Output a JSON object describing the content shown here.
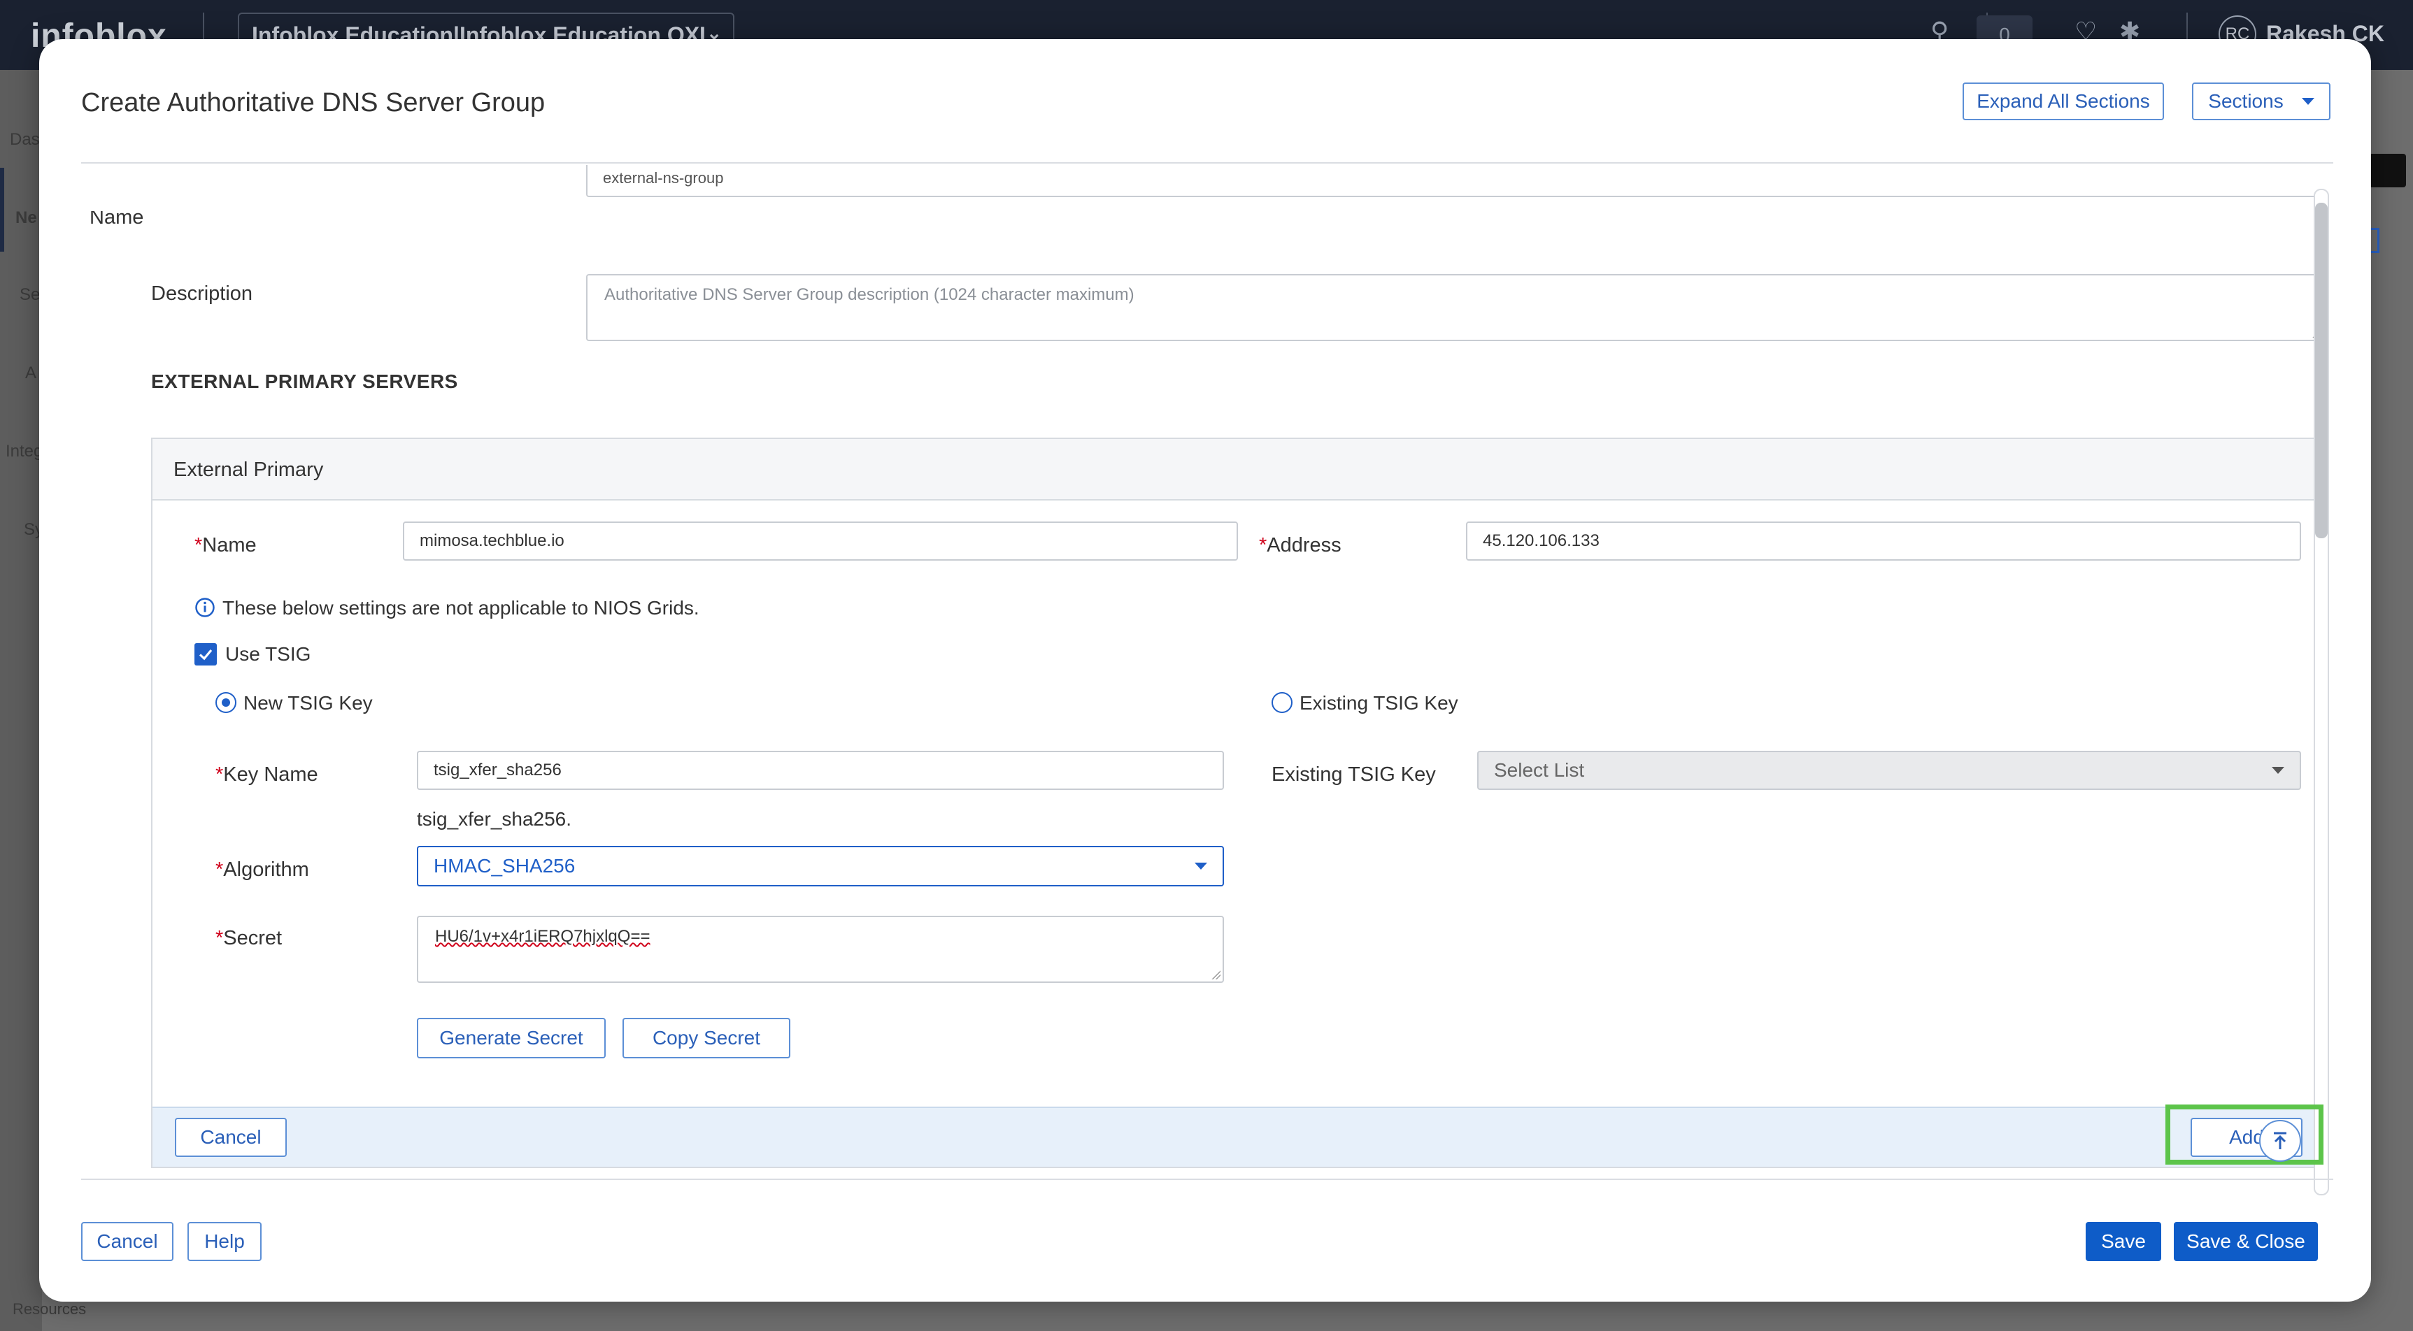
{
  "background": {
    "logo": "infoblox",
    "tenant": "Infoblox Education|Infoblox Education OXI",
    "notification_count": "0",
    "user_initials": "RC",
    "user_name": "Rakesh CK",
    "nav_fragments": [
      "Das",
      "Ne",
      "Se",
      "A",
      "Integ",
      "Sy",
      "Resources"
    ]
  },
  "modal": {
    "title": "Create Authoritative DNS Server Group",
    "expand_label": "Expand All Sections",
    "sections_label": "Sections",
    "footer": {
      "cancel": "Cancel",
      "help": "Help",
      "save": "Save",
      "save_close": "Save & Close"
    }
  },
  "form": {
    "name_label": "Name",
    "name_value": "external-ns-group",
    "description_label": "Description",
    "description_placeholder": "Authoritative DNS Server Group description (1024 character maximum)",
    "section_title": "EXTERNAL PRIMARY SERVERS"
  },
  "panel": {
    "title": "External Primary",
    "name_label": "Name",
    "name_value": "mimosa.techblue.io",
    "address_label": "Address",
    "address_value": "45.120.106.133",
    "info_text": "These below settings are not applicable to NIOS Grids.",
    "use_tsig_label": "Use TSIG",
    "use_tsig_checked": true,
    "new_tsig_label": "New TSIG Key",
    "existing_tsig_radio_label": "Existing TSIG Key",
    "key_name_label": "Key Name",
    "key_name_value": "tsig_xfer_sha256",
    "key_name_hint": "tsig_xfer_sha256.",
    "existing_tsig_label": "Existing TSIG Key",
    "existing_tsig_placeholder": "Select List",
    "algorithm_label": "Algorithm",
    "algorithm_value": "HMAC_SHA256",
    "secret_label": "Secret",
    "secret_value": "HU6/1v+x4r1iERQ7hjxlqQ==",
    "generate_secret": "Generate Secret",
    "copy_secret": "Copy Secret",
    "cancel": "Cancel",
    "add": "Add"
  },
  "colors": {
    "accent": "#0e5cc8",
    "highlight": "#5cc44a",
    "required": "#d0021b"
  }
}
